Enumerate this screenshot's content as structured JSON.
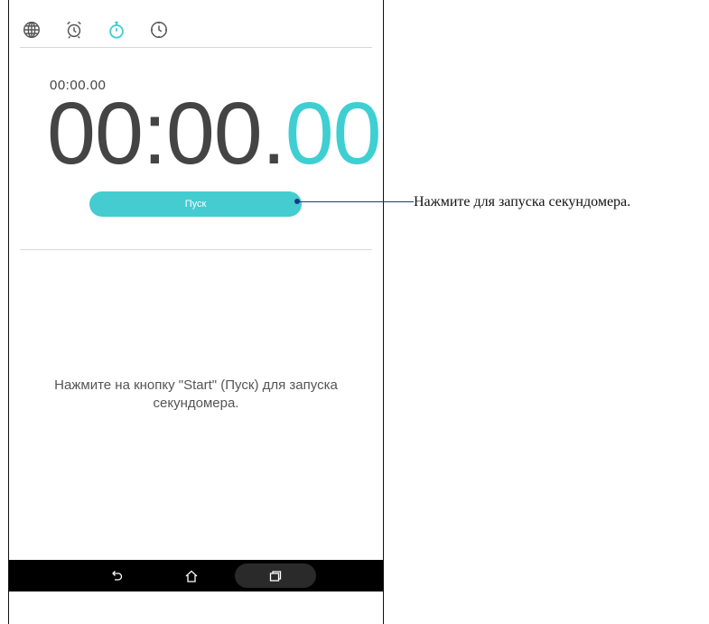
{
  "tabs": [
    {
      "name": "world-clock",
      "icon": "globe-icon"
    },
    {
      "name": "alarm",
      "icon": "alarm-clock-icon"
    },
    {
      "name": "stopwatch",
      "icon": "stopwatch-icon",
      "active": true
    },
    {
      "name": "timer",
      "icon": "timer-icon"
    }
  ],
  "stopwatch": {
    "lap_time": "00:00.00",
    "main_time": "00:00.",
    "hundredths": "00",
    "start_label": "Пуск",
    "hint": "Нажмите на кнопку \"Start\" (Пуск) для запуска секундомера."
  },
  "callout": {
    "text": "Нажмите для запуска секундомера."
  },
  "navbar": {
    "back_icon": "back-icon",
    "home_icon": "home-icon",
    "recent_icon": "recent-apps-icon"
  },
  "colors": {
    "accent": "#44ccd0",
    "text": "#444444",
    "navbar": "#000000",
    "callout_line": "#1a3a80"
  }
}
